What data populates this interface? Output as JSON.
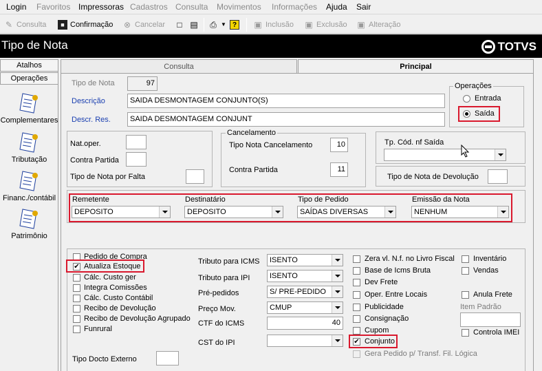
{
  "menu": {
    "items": [
      "Login",
      "Favoritos",
      "Impressoras",
      "Cadastros",
      "Consulta",
      "Movimentos",
      "Informações",
      "Ajuda",
      "Sair"
    ]
  },
  "toolbar": {
    "consulta": "Consulta",
    "confirmacao": "Confirmação",
    "cancelar": "Cancelar",
    "inclusao": "Inclusão",
    "exclusao": "Exclusão",
    "alteracao": "Alteração"
  },
  "window_title": "Tipo de Nota",
  "brand": "TOTVS",
  "sidebar": {
    "atalhos": "Atalhos",
    "operacoes": "Operações",
    "items": [
      "Complementares",
      "Tributação",
      "Financ./contábil",
      "Patrimônio"
    ]
  },
  "tabs": [
    "Consulta",
    "Principal"
  ],
  "form": {
    "tipo_nota_label": "Tipo de Nota",
    "tipo_nota_value": "97",
    "descricao_label": "Descrição",
    "descricao_value": "SAIDA DESMONTAGEM CONJUNTO(S)",
    "descr_res_label": "Descr. Res.",
    "descr_res_value": "SAIDA DESMONTAGEM CONJUNT",
    "operacoes_title": "Operações",
    "entrada": "Entrada",
    "saida": "Saída",
    "nat_oper": "Nat.oper.",
    "contra_partida": "Contra Partida",
    "tipo_nota_falta": "Tipo de Nota por Falta",
    "cancelamento_title": "Cancelamento",
    "tipo_nota_cancel_label": "Tipo Nota Cancelamento",
    "tipo_nota_cancel_value": "10",
    "contra_partida_cancel_label": "Contra Partida",
    "contra_partida_cancel_value": "11",
    "tp_cod_nf_saida": "Tp. Cód. nf Saída",
    "tipo_nota_devolucao": "Tipo de Nota de Devolução",
    "remetente_label": "Remetente",
    "remetente_value": "DEPOSITO",
    "destinatario_label": "Destinatário",
    "destinatario_value": "DEPOSITO",
    "tipo_pedido_label": "Tipo de Pedido",
    "tipo_pedido_value": "SAÍDAS DIVERSAS",
    "emissao_nota_label": "Emissão da Nota",
    "emissao_nota_value": "NENHUM",
    "left_checks": [
      "Pedido de Compra",
      "Atualiza Estoque",
      "Cálc. Custo ger",
      "Integra Comissões",
      "Cálc. Custo Contábil",
      "Recibo de Devolução",
      "Recibo de Devolução Agrupado",
      "Funrural"
    ],
    "tipo_docto_externo": "Tipo Docto Externo",
    "tributo_icms_label": "Tributo para ICMS",
    "tributo_icms_value": "ISENTO",
    "tributo_ipi_label": "Tributo para IPI",
    "tributo_ipi_value": "ISENTO",
    "pre_pedidos_label": "Pré-pedidos",
    "pre_pedidos_value": "S/ PRE-PEDIDO",
    "preco_mov_label": "Preço Mov.",
    "preco_mov_value": "CMUP",
    "ctf_icms_label": "CTF do ICMS",
    "ctf_icms_value": "40",
    "cst_ipi_label": "CST do IPI",
    "cst_ipi_value": "",
    "mid_checks": [
      "Zera vl. N.f. no Livro Fiscal",
      "Base de Icms Bruta",
      "Dev Frete",
      "Oper. Entre Locais",
      "Publicidade",
      "Consignação",
      "Cupom",
      "Conjunto",
      "Gera Pedido p/ Transf. Fil. Lógica"
    ],
    "right_checks": [
      "Inventário",
      "Vendas",
      "Anula Frete",
      "Controla IMEI"
    ],
    "item_padrao": "Item Padrão"
  }
}
